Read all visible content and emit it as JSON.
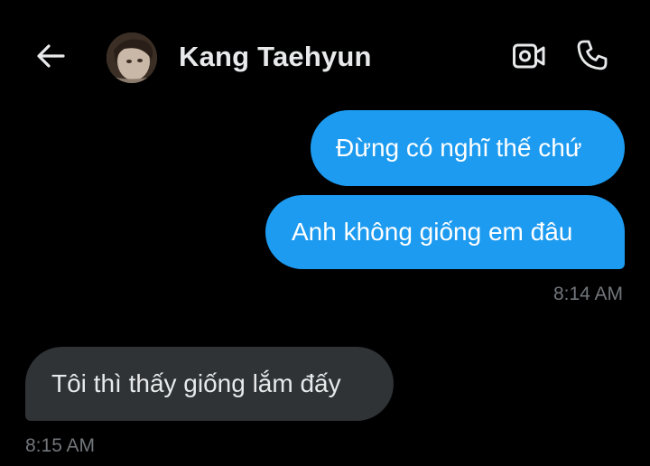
{
  "header": {
    "contact_name": "Kang Taehyun",
    "back_icon": "arrow-left-icon",
    "video_icon": "video-camera-icon",
    "call_icon": "phone-icon"
  },
  "messages": [
    {
      "direction": "sent",
      "text": "Đừng có nghĩ thế chứ"
    },
    {
      "direction": "sent",
      "text": "Anh không giống em đâu",
      "time": "8:14 AM"
    },
    {
      "direction": "received",
      "text": "Tôi thì thấy giống lắm đấy",
      "time": "8:15 AM"
    }
  ],
  "colors": {
    "background": "#000000",
    "sent_bubble": "#1d9bf0",
    "received_bubble": "#2f3336",
    "timestamp": "#71767b",
    "text": "#e7e9ea"
  }
}
